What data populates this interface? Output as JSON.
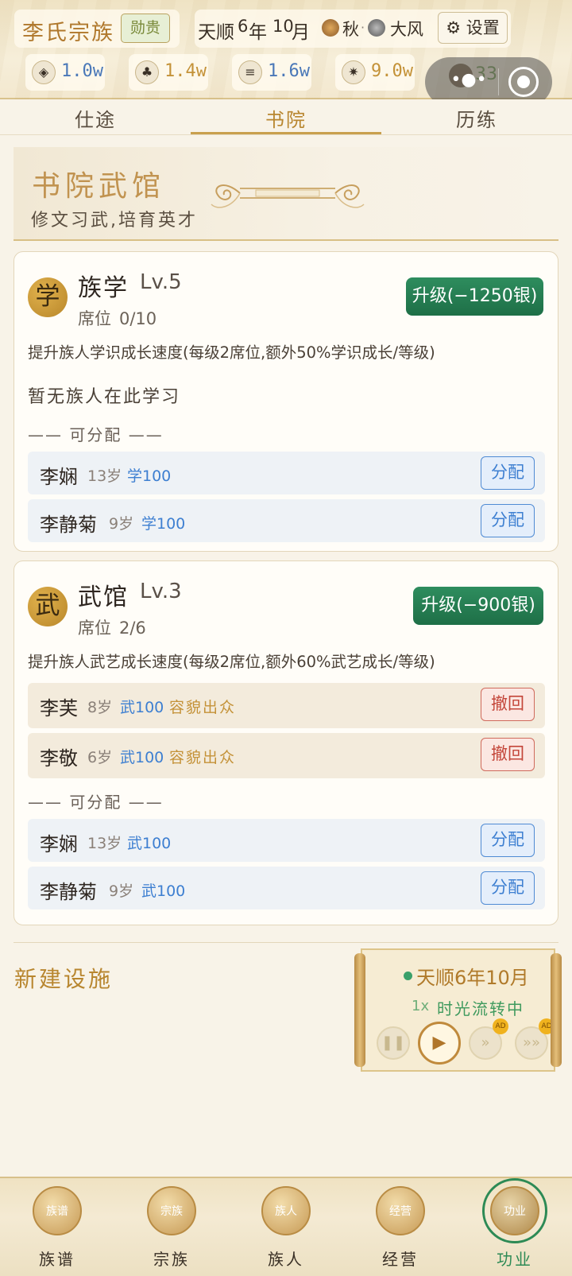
{
  "header": {
    "clan_name": "李氏宗族",
    "clan_badge": "勋贵",
    "era": "天顺",
    "year": "6",
    "year_unit": "年",
    "month": "10",
    "month_unit": "月",
    "season": "秋",
    "separator": "·",
    "weather": "大风",
    "settings_label": "设置",
    "resources": [
      {
        "name": "silver-icon",
        "value": "1.0w",
        "color": "#4a78b8"
      },
      {
        "name": "grain-bag-icon",
        "value": "1.4w",
        "color": "#c49238"
      },
      {
        "name": "cloth-icon",
        "value": "1.6w",
        "color": "#4a78b8"
      },
      {
        "name": "fame-icon",
        "value": "9.0w",
        "color": "#c49238"
      }
    ],
    "people_count": "33"
  },
  "tabs": [
    {
      "label": "仕途"
    },
    {
      "label": "书院"
    },
    {
      "label": "历练"
    }
  ],
  "banner": {
    "title": "书院武馆",
    "subtitle": "修文习武,培育英才"
  },
  "academy": {
    "seal": "学",
    "name": "族学",
    "level": "Lv.5",
    "seat_label": "席位",
    "seats": "0/10",
    "upgrade_label": "升级(−1250银)",
    "description": "提升族人学识成长速度(每级2席位,额外50%学识成长/等级)",
    "empty_text": "暂无族人在此学习",
    "available_label": "—— 可分配 ——",
    "available": [
      {
        "name": "李娴",
        "age": "13岁",
        "stat": "学100",
        "action": "分配"
      },
      {
        "name": "李静菊",
        "age": "9岁",
        "stat": "学100",
        "action": "分配"
      }
    ]
  },
  "martial": {
    "seal": "武",
    "name": "武馆",
    "level": "Lv.3",
    "seat_label": "席位",
    "seats": "2/6",
    "upgrade_label": "升级(−900银)",
    "description": "提升族人武艺成长速度(每级2席位,额外60%武艺成长/等级)",
    "enrolled": [
      {
        "name": "李芙",
        "age": "8岁",
        "stat": "武100",
        "trait": "容貌出众",
        "action": "撤回"
      },
      {
        "name": "李敬",
        "age": "6岁",
        "stat": "武100",
        "trait": "容貌出众",
        "action": "撤回"
      }
    ],
    "available_label": "—— 可分配 ——",
    "available": [
      {
        "name": "李娴",
        "age": "13岁",
        "stat": "武100",
        "action": "分配"
      },
      {
        "name": "李静菊",
        "age": "9岁",
        "stat": "武100",
        "action": "分配"
      }
    ]
  },
  "new_facility": "新建设施",
  "time_panel": {
    "date": "天顺6年10月",
    "speed": "1x",
    "status": "时光流转中",
    "ad_badge": "AD"
  },
  "bottom_nav": [
    {
      "label": "族谱",
      "icon_text": "族谱"
    },
    {
      "label": "宗族",
      "icon_text": "宗族"
    },
    {
      "label": "族人",
      "icon_text": "族人"
    },
    {
      "label": "经营",
      "icon_text": "经营"
    },
    {
      "label": "功业",
      "icon_text": "功业"
    }
  ],
  "colors": {
    "accent_gold": "#c19350",
    "upgrade_green": "#1e6f47",
    "assign_blue": "#3d7fd1",
    "recall_red": "#c4463a"
  }
}
